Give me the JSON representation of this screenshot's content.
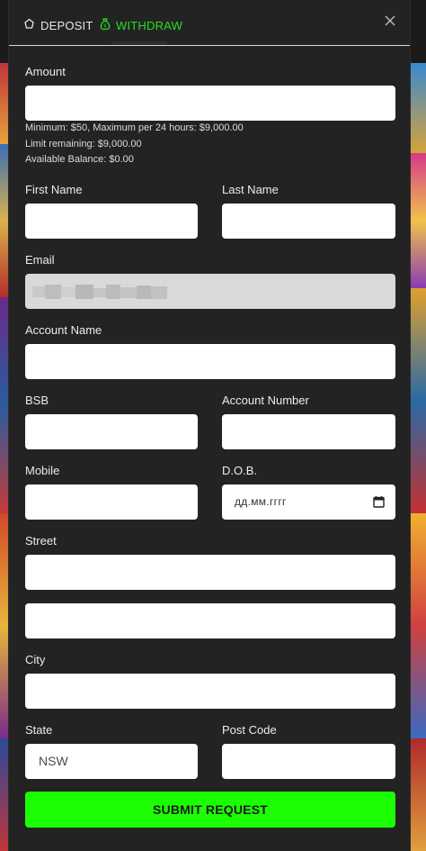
{
  "tabs": {
    "deposit": "DEPOSIT",
    "withdraw": "WITHDRAW",
    "active": "withdraw",
    "active_color": "#27e01d"
  },
  "form": {
    "amount_label": "Amount",
    "limits": {
      "minmax": "Minimum: $50, Maximum per 24 hours: $9,000.00",
      "remaining": "Limit remaining: $9,000.00",
      "balance": "Available Balance: $0.00"
    },
    "first_name_label": "First Name",
    "last_name_label": "Last Name",
    "email_label": "Email",
    "account_name_label": "Account Name",
    "bsb_label": "BSB",
    "account_number_label": "Account Number",
    "mobile_label": "Mobile",
    "dob_label": "D.O.B.",
    "dob_placeholder": "дд.мм.гггг",
    "street_label": "Street",
    "city_label": "City",
    "state_label": "State",
    "state_value": "NSW",
    "post_code_label": "Post Code",
    "submit_label": "SUBMIT REQUEST"
  },
  "colors": {
    "submit": "#1cff03",
    "modal_bg": "#232323",
    "input_bg": "#ffffff",
    "disabled_bg": "#d9d9d9"
  },
  "icons": {
    "deposit": "deposit-icon",
    "withdraw": "money-bag-icon",
    "close": "close-icon",
    "calendar": "calendar-icon"
  }
}
